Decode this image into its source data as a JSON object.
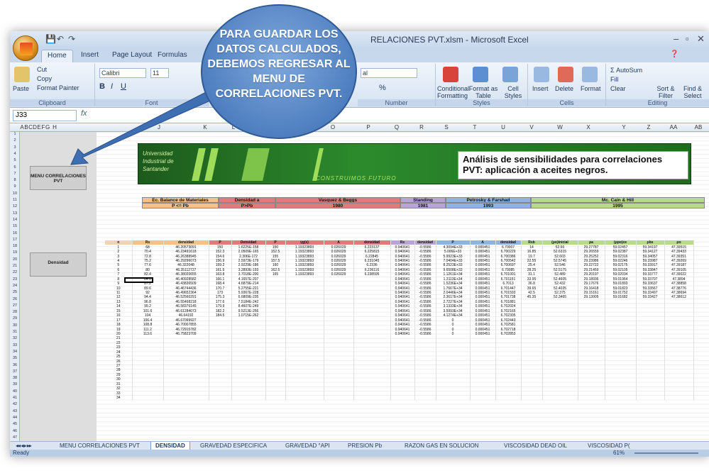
{
  "window": {
    "title": "RELACIONES PVT.xlsm - Microsoft Excel",
    "controls": [
      "–",
      "▫",
      "✕"
    ]
  },
  "ribbon_tabs": [
    "Home",
    "Insert",
    "Page Layout",
    "Formulas"
  ],
  "ribbon": {
    "clipboard": {
      "cut": "Cut",
      "copy": "Copy",
      "paste": "Paste",
      "format_painter": "Format Painter",
      "label": "Clipboard"
    },
    "font": {
      "name": "Calibri",
      "size": "11",
      "label": "Font"
    },
    "number": {
      "format": "al",
      "percent": "%",
      "label": "Number"
    },
    "styles": {
      "conditional": "Conditional Formatting",
      "format_table": "Format as Table",
      "cell_styles": "Cell Styles",
      "label": "Styles"
    },
    "cells": {
      "insert": "Insert",
      "delete": "Delete",
      "format": "Format",
      "label": "Cells"
    },
    "editing": {
      "autosum": "AutoSum",
      "fill": "Fill",
      "clear": "Clear",
      "sort": "Sort & Filter",
      "find": "Find & Select",
      "label": "Editing"
    }
  },
  "formula_bar": {
    "name_box": "J33",
    "fx": "fx"
  },
  "columns": [
    "A",
    "B",
    "C",
    "D",
    "E",
    "F",
    "G",
    "H",
    "J",
    "K",
    "L",
    "M",
    "N",
    "O",
    "P",
    "Q",
    "R",
    "S",
    "T",
    "U",
    "V",
    "W",
    "X",
    "Y",
    "Z",
    "AA",
    "AB"
  ],
  "side_buttons": {
    "menu": "MENU CORRELACIONES PVT",
    "density": "Densidad"
  },
  "banner": {
    "university": "Universidad Industrial de Santander",
    "tagline": "CONSTRUIMOS FUTURO",
    "title": "Análisis de sensibilidades para correlaciones PVT: aplicación a aceites negros."
  },
  "headers": {
    "balance": "Ec. Balance de Materiales",
    "balance_sub": "P <= Pb",
    "densidad": "Densidad a",
    "densidad_sub": "P>Pb",
    "vasquez": "Vasquez & Beggs",
    "vasquez_year": "1980",
    "standing": "Standing",
    "standing_year": "1981",
    "petrosky": "Petrosky & Farshad",
    "petrosky_year": "1993",
    "mccain": "Mc. Cain & Hill",
    "mccain_year": "1995",
    "cols": [
      "n",
      "Rs",
      "densidad",
      "P",
      "Densidad",
      "P",
      "γg(s)",
      "A",
      "densidad",
      "Rs",
      "densidad",
      "P",
      "A",
      "densidad",
      "Rsb",
      "(ρo)inicial",
      "ρa",
      "(ρpo)ce",
      "ρbs",
      "ρo"
    ]
  },
  "rows": [
    [
      "1",
      "68",
      "46.20573091",
      "150",
      "1.6225E-158",
      "150",
      "1.19323893",
      "0.026029",
      "6.223137",
      "0.940641",
      "-0.5586",
      "4.3094E+33",
      "0.000451",
      "6.70007",
      "14",
      "52.66",
      "29.27787",
      "59.02457",
      "59.34197",
      "47.39515"
    ],
    [
      "2",
      "70.4",
      "46.23491618",
      "152.3",
      "2.0509E-165",
      "152.5",
      "1.19323893",
      "0.026029",
      "6.225815",
      "0.940641",
      "-0.5586",
      "5.006E+33",
      "0.000451",
      "6.700229",
      "16.85",
      "52.6315",
      "29.26559",
      "59.02387",
      "59.34127",
      "47.39433"
    ],
    [
      "3",
      "72.8",
      "46.26388945",
      "154.6",
      "2.306E-172",
      "155",
      "1.19323893",
      "0.026029",
      "6.22845",
      "0.940641",
      "-0.5586",
      "5.9923E+33",
      "0.000451",
      "6.700386",
      "19.7",
      "52.603",
      "29.25252",
      "59.02316",
      "59.34057",
      "47.39351"
    ],
    [
      "4",
      "75.2",
      "46.29296073",
      "156.9",
      "2.5973E-179",
      "157.5",
      "1.19323893",
      "0.026029",
      "6.231045",
      "0.940641",
      "-0.5586",
      "7.0404E+33",
      "0.000451",
      "6.700542",
      "22.55",
      "52.5745",
      "29.23986",
      "59.02246",
      "59.33987",
      "47.39269"
    ],
    [
      "5",
      "77.6",
      "46.322048",
      "159.2",
      "2.9229E-186",
      "160",
      "1.19323893",
      "0.026029",
      "6.2336",
      "0.940641",
      "-0.5586",
      "8.2523E+33",
      "0.000451",
      "6.700697",
      "25.4",
      "52.546",
      "29.22722",
      "59.02175",
      "59.33917",
      "47.39187"
    ],
    [
      "6",
      "80",
      "46.35112727",
      "161.5",
      "3.2893E-193",
      "162.5",
      "1.19323893",
      "0.026029",
      "6.236116",
      "0.940641",
      "-0.5586",
      "9.6508E+33",
      "0.000451",
      "6.70085",
      "28.25",
      "52.5175",
      "29.21459",
      "59.02105",
      "59.33847",
      "47.39105"
    ],
    [
      "7",
      "82.4",
      "46.38020655",
      "163.8",
      "3.7018E-200",
      "165",
      "1.19323893",
      "0.026029",
      "6.238595",
      "0.940641",
      "-0.5586",
      "1.1261E+34",
      "0.000451",
      "6.701001",
      "31.1",
      "52.489",
      "29.20197",
      "59.02034",
      "59.33777",
      "47.39022"
    ],
    [
      "8",
      "84.8",
      "46.40928582",
      "166.1",
      "4.1657E-207",
      "",
      "",
      "",
      "",
      "0.940641",
      "-0.5586",
      "1.3113E+34",
      "0.000451",
      "6.701151",
      "33.95",
      "52.4605",
      "29.18936",
      "59.01964",
      "59.33707",
      "47.3894"
    ],
    [
      "9",
      "87.2",
      "46.43836509",
      "168.4",
      "4.6879E-214",
      "",
      "",
      "",
      "",
      "0.940641",
      "-0.5586",
      "1.5236E+34",
      "0.000451",
      "6.7013",
      "36.8",
      "52.432",
      "29.17676",
      "59.01893",
      "59.33637",
      "47.38858"
    ],
    [
      "10",
      "89.6",
      "46.46744436",
      "170.7",
      "5.2755E-221",
      "",
      "",
      "",
      "",
      "0.940641",
      "-0.5586",
      "1.7667E+34",
      "0.000451",
      "6.701447",
      "39.65",
      "52.4035",
      "29.16418",
      "59.01823",
      "59.33567",
      "47.38776"
    ],
    [
      "11",
      "92",
      "46.49652364",
      "173",
      "5.9367E-228",
      "",
      "",
      "",
      "",
      "0.940641",
      "-0.5586",
      "2.0446E+34",
      "0.000451",
      "6.701593",
      "42.5",
      "52.375",
      "29.15161",
      "59.01752",
      "59.33497",
      "47.38694"
    ],
    [
      "12",
      "94.4",
      "46.52560291",
      "175.3",
      "6.6809E-235",
      "",
      "",
      "",
      "",
      "0.940641",
      "-0.5586",
      "2.3617E+34",
      "0.000451",
      "6.701738",
      "45.35",
      "52.3465",
      "29.13905",
      "59.01682",
      "59.33427",
      "47.38612"
    ],
    [
      "13",
      "96.8",
      "46.55468218",
      "177.6",
      "7.5184E-242",
      "",
      "",
      "",
      "",
      "0.940641",
      "-0.5586",
      "2.7227E+34",
      "0.000451",
      "6.701881",
      "",
      "",
      "",
      "",
      "",
      ""
    ],
    [
      "14",
      "99.2",
      "46.58376145",
      "179.9",
      "8.4607E-249",
      "",
      "",
      "",
      "",
      "0.940641",
      "-0.5586",
      "3.1333E+34",
      "0.000451",
      "6.702024",
      "",
      "",
      "",
      "",
      "",
      ""
    ],
    [
      "15",
      "101.6",
      "46.61284073",
      "182.2",
      "9.5213E-256",
      "",
      "",
      "",
      "",
      "0.940641",
      "-0.5586",
      "3.5993E+34",
      "0.000451",
      "6.702165",
      "",
      "",
      "",
      "",
      "",
      ""
    ],
    [
      "16",
      "104",
      "46.64192",
      "184.5",
      "1.0715E-262",
      "",
      "",
      "",
      "",
      "0.940641",
      "-0.5586",
      "4.1274E+34",
      "0.000451",
      "6.702305",
      "",
      "",
      "",
      "",
      "",
      ""
    ],
    [
      "17",
      "106.4",
      "46.67099927",
      "",
      "",
      "",
      "",
      "",
      "",
      "0.940641",
      "-0.5586",
      "0",
      "0.000451",
      "6.702443",
      "",
      "",
      "",
      "",
      "",
      ""
    ],
    [
      "18",
      "108.8",
      "46.70007855",
      "",
      "",
      "",
      "",
      "",
      "",
      "0.940641",
      "-0.5586",
      "0",
      "0.000451",
      "6.702581",
      "",
      "",
      "",
      "",
      "",
      ""
    ],
    [
      "19",
      "111.2",
      "46.72915782",
      "",
      "",
      "",
      "",
      "",
      "",
      "0.940641",
      "-0.5586",
      "0",
      "0.000451",
      "6.702718",
      "",
      "",
      "",
      "",
      "",
      ""
    ],
    [
      "20",
      "113.6",
      "46.75823709",
      "",
      "",
      "",
      "",
      "",
      "",
      "0.940641",
      "-0.5586",
      "0",
      "0.000451",
      "6.702853",
      "",
      "",
      "",
      "",
      "",
      ""
    ]
  ],
  "extra_n": [
    "21",
    "22",
    "23",
    "24",
    "25",
    "26",
    "27",
    "28",
    "29",
    "30",
    "31",
    "32",
    "33",
    "34"
  ],
  "sheet_tabs": [
    "MENU CORRELACIONES PVT",
    "DENSIDAD",
    "GRAVEDAD ESPECIFICA",
    "GRAVEDAD °API",
    "PRESION Pb",
    "RAZON GAS EN SOLUCION",
    "VISCOSIDAD DEAD OIL",
    "VISCOSIDAD P("
  ],
  "status": {
    "ready": "Ready",
    "zoom": "61%"
  },
  "callout": "PARA GUARDAR LOS DATOS CALCULADOS, DEBEMOS REGRESAR AL MENU DE CORRELACIONES PVT."
}
